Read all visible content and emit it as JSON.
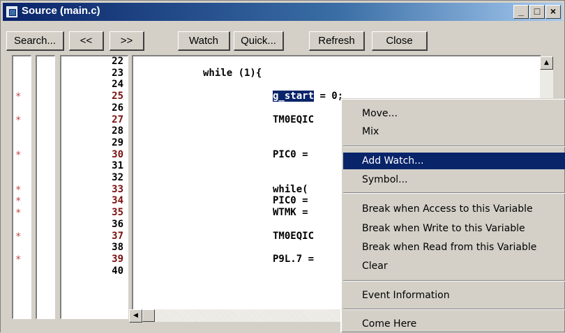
{
  "window": {
    "title": "Source (main.c)",
    "controls": {
      "minimize": "_",
      "maximize": "□",
      "close": "×"
    }
  },
  "toolbar": {
    "buttons": [
      "Search...",
      "<<",
      ">>",
      "Watch",
      "Quick...",
      "Refresh",
      "Close"
    ]
  },
  "gutter": {
    "marker": "*",
    "line_numbers": [
      "22",
      "23",
      "24",
      "25",
      "26",
      "27",
      "28",
      "29",
      "30",
      "31",
      "32",
      "33",
      "34",
      "35",
      "36",
      "37",
      "38",
      "39",
      "40"
    ],
    "breakpoint_lines": [
      "25",
      "27",
      "30",
      "33",
      "34",
      "35",
      "37",
      "39"
    ]
  },
  "code": {
    "lines": [
      {
        "n": "22",
        "text": ""
      },
      {
        "n": "23",
        "text": "while (1){"
      },
      {
        "n": "24",
        "text": ""
      },
      {
        "n": "25",
        "highlight": "g_start",
        "rest": " = 0;"
      },
      {
        "n": "26",
        "text": ""
      },
      {
        "n": "27",
        "text": "TM0EQIC"
      },
      {
        "n": "28",
        "text": ""
      },
      {
        "n": "29",
        "text": ""
      },
      {
        "n": "30",
        "text": "PIC0 ="
      },
      {
        "n": "31",
        "text": ""
      },
      {
        "n": "32",
        "text": ""
      },
      {
        "n": "33",
        "text": "while("
      },
      {
        "n": "34",
        "text": "PIC0 ="
      },
      {
        "n": "35",
        "text": "WTMK ="
      },
      {
        "n": "36",
        "text": ""
      },
      {
        "n": "37",
        "text": "TM0EQIC"
      },
      {
        "n": "38",
        "text": ""
      },
      {
        "n": "39",
        "text": "P9L.7 ="
      },
      {
        "n": "40",
        "text": ""
      }
    ]
  },
  "context_menu": {
    "items": [
      "Move...",
      "Mix",
      "Add Watch...",
      "Symbol...",
      "Break when Access to this Variable",
      "Break when Write to this Variable",
      "Break when Read from this Variable",
      "Clear",
      "Event Information",
      "Come Here"
    ],
    "selected": "Add Watch..."
  },
  "scrollbar": {
    "up_arrow": "▲",
    "left_arrow": "◀"
  },
  "colors": {
    "title_bar": "#0a246a",
    "selection": "#0a246a",
    "breakpoint_marker": "#c04848",
    "face": "#d4d0c8"
  }
}
